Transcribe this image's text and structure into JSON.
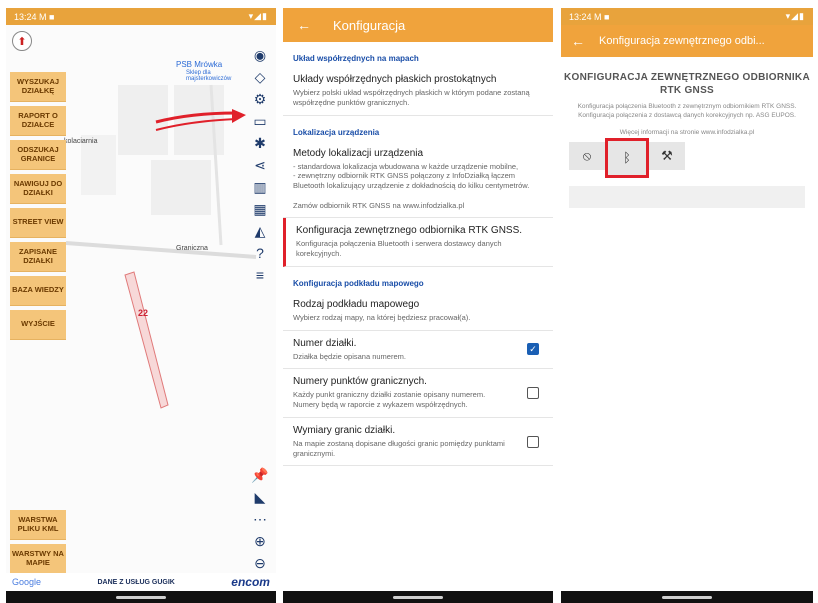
{
  "status": {
    "time": "13:24",
    "time_icons": "M ■",
    "right": "▾◢▮"
  },
  "panel1": {
    "left_buttons": [
      "WYSZUKAJ DZIAŁKĘ",
      "RAPORT O DZIAŁCE",
      "ODSZUKAJ GRANICE",
      "NAWIGUJ DO DZIAŁKI",
      "STREET VIEW",
      "ZAPISANE DZIAŁKI",
      "BAZA WIEDZY",
      "WYJŚCIE"
    ],
    "bottom_buttons": [
      "WARSTWA PLIKU KML",
      "WARSTWY NA MAPIE"
    ],
    "map_labels": {
      "shop": "PSB Mrówka",
      "shop_sub": "Sklep dla majsterkowiczów",
      "street": "Graniczna",
      "place": "kolaciarnia",
      "parcel": "22"
    },
    "google": "Google",
    "services": "DANE Z USŁUG GUGIK",
    "brand": "encom"
  },
  "panel2": {
    "title": "Konfiguracja",
    "sections": [
      {
        "header": "Układ współrzędnych na mapach",
        "items": [
          {
            "title": "Układy współrzędnych płaskich prostokątnych",
            "sub": "Wybierz polski układ współrzędnych płaskich w którym podane zostaną współrzędne punktów granicznych."
          }
        ]
      },
      {
        "header": "Lokalizacja urządzenia",
        "items": [
          {
            "title": "Metody lokalizacji urządzenia",
            "sub": "- standardowa lokalizacja wbudowana w każde urządzenie mobilne,\n- zewnętrzny odbiornik RTK GNSS połączony z InfoDziałką łączem Bluetooth lokalizujący urządzenie z dokładnością do kilku centymetrów.\n\nZamów odbiornik RTK GNSS na www.infodzialka.pl"
          },
          {
            "title": "Konfiguracja zewnętrznego odbiornika RTK GNSS.",
            "sub": "Konfiguracja połączenia Bluetooth i serwera dostawcy danych korekcyjnych."
          }
        ]
      },
      {
        "header": "Konfiguracja podkładu mapowego",
        "items": [
          {
            "title": "Rodzaj podkładu mapowego",
            "sub": "Wybierz rodzaj mapy, na której będziesz pracował(a)."
          },
          {
            "title": "Numer działki.",
            "sub": "Działka będzie opisana numerem.",
            "checked": true
          },
          {
            "title": "Numery punktów granicznych.",
            "sub": "Każdy punkt graniczny działki zostanie opisany numerem. Numery będą w raporcie z wykazem współrzędnych.",
            "checked": false
          },
          {
            "title": "Wymiary granic działki.",
            "sub": "Na mapie zostaną dopisane długości granic pomiędzy punktami granicznymi.",
            "checked": false
          }
        ]
      }
    ]
  },
  "panel3": {
    "title": "Konfiguracja zewnętrznego odbi...",
    "heading": "KONFIGURACJA ZEWNĘTRZNEGO ODBIORNIKA RTK GNSS",
    "desc": "Konfiguracja połączenia Bluetooth z zewnętrznym odbiornikiem RTK GNSS. Konfiguracja połączenia z dostawcą danych korekcyjnych np. ASG EUPOS.",
    "more": "Więcej informacji na stronie www.infodzialka.pl",
    "buttons": [
      "gps-off-icon",
      "bluetooth-icon",
      "tools-icon"
    ]
  },
  "colors": {
    "accent": "#f0a33c",
    "link": "#1a4ea8",
    "annotation": "#e0202a"
  }
}
